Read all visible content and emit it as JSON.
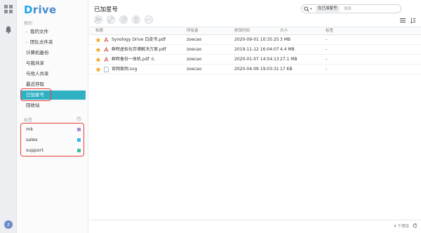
{
  "app": {
    "logo_text": "rive",
    "logo_letter": "D"
  },
  "rail": {
    "avatar_text": "z"
  },
  "sidebar": {
    "section_label": "类别",
    "items": [
      {
        "label": "我的文件",
        "caret": "›"
      },
      {
        "label": "团队文件夹",
        "caret": "›"
      },
      {
        "label": "计算机备份"
      },
      {
        "label": "与我共享"
      },
      {
        "label": "与他人共享"
      },
      {
        "label": "最近存取"
      },
      {
        "label": "已加星号"
      },
      {
        "label": "回收站"
      }
    ],
    "tags_label": "标签",
    "tags_plus": "+",
    "tags": [
      {
        "label": "mk",
        "color": "#a78bd6"
      },
      {
        "label": "sales",
        "color": "#32b7e6"
      },
      {
        "label": "support",
        "color": "#3dbfa3"
      }
    ]
  },
  "main": {
    "title": "已加星号",
    "search": {
      "dropdown": "▾",
      "scope": "在已加星号",
      "placeholder": "搜索"
    },
    "columns": [
      "标题",
      "所有者",
      "修改时间",
      "大小",
      "标签"
    ],
    "rows": [
      {
        "name": "Synology Drive 白皮书.pdf",
        "owner": "zoecao",
        "modified": "2020-09-01 10:35:25",
        "size": "3 MB",
        "tag": "-",
        "type": "pdf",
        "extra": ""
      },
      {
        "name": "群晖虚拟化存储解决方案.pdf",
        "owner": "zoecao",
        "modified": "2019-11-12 16:04:07",
        "size": "4.4 MB",
        "tag": "-",
        "type": "pdf",
        "extra": ""
      },
      {
        "name": "群晖备份一体机.pdf",
        "owner": "zoecao",
        "modified": "2020-01-07 14:54:13",
        "size": "27.1 MB",
        "tag": "-",
        "type": "pdf",
        "extra": "ㄠ"
      },
      {
        "name": "官网案例.svg",
        "owner": "zoecao",
        "modified": "2020-04-09 19:03:31",
        "size": "17 KB",
        "tag": "-",
        "type": "svg",
        "extra": ""
      }
    ],
    "footer_count": "4 个项目",
    "colors": {
      "accent": "#2fb0c3",
      "star": "#f5a623",
      "annotation": "#e6403a"
    }
  }
}
